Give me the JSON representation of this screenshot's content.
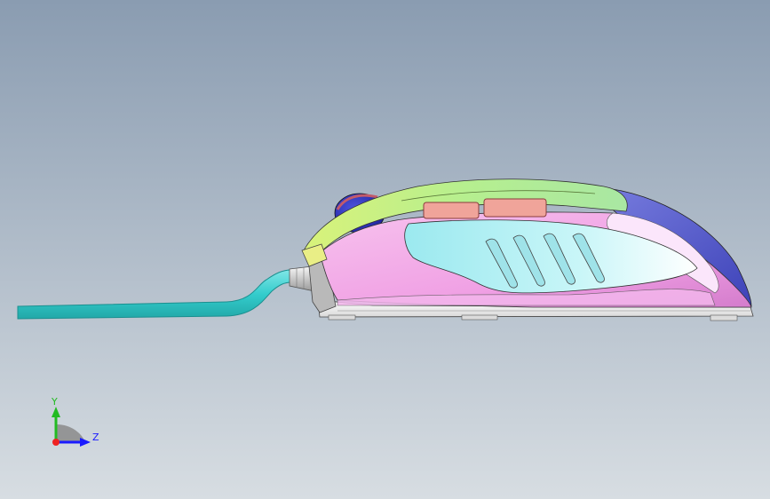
{
  "viewport": {
    "background_top": "#8a9cb1",
    "background_bottom": "#d7dde2"
  },
  "model": {
    "icon": "computer-mouse-side-view",
    "cable_color": "#33cccc",
    "shell_pink": "#f2a6e6",
    "panel_cyan": "#aef1f4",
    "top_green": "#b8ef8c",
    "back_blue": "#5a5fcf",
    "button_salmon": "#f0a49a",
    "base_white": "#f4f4f4"
  },
  "triad": {
    "y_label": "Y",
    "z_label": "Z",
    "y_color": "#22bb22",
    "z_color": "#1a1aff",
    "x_color": "#ee2222"
  }
}
